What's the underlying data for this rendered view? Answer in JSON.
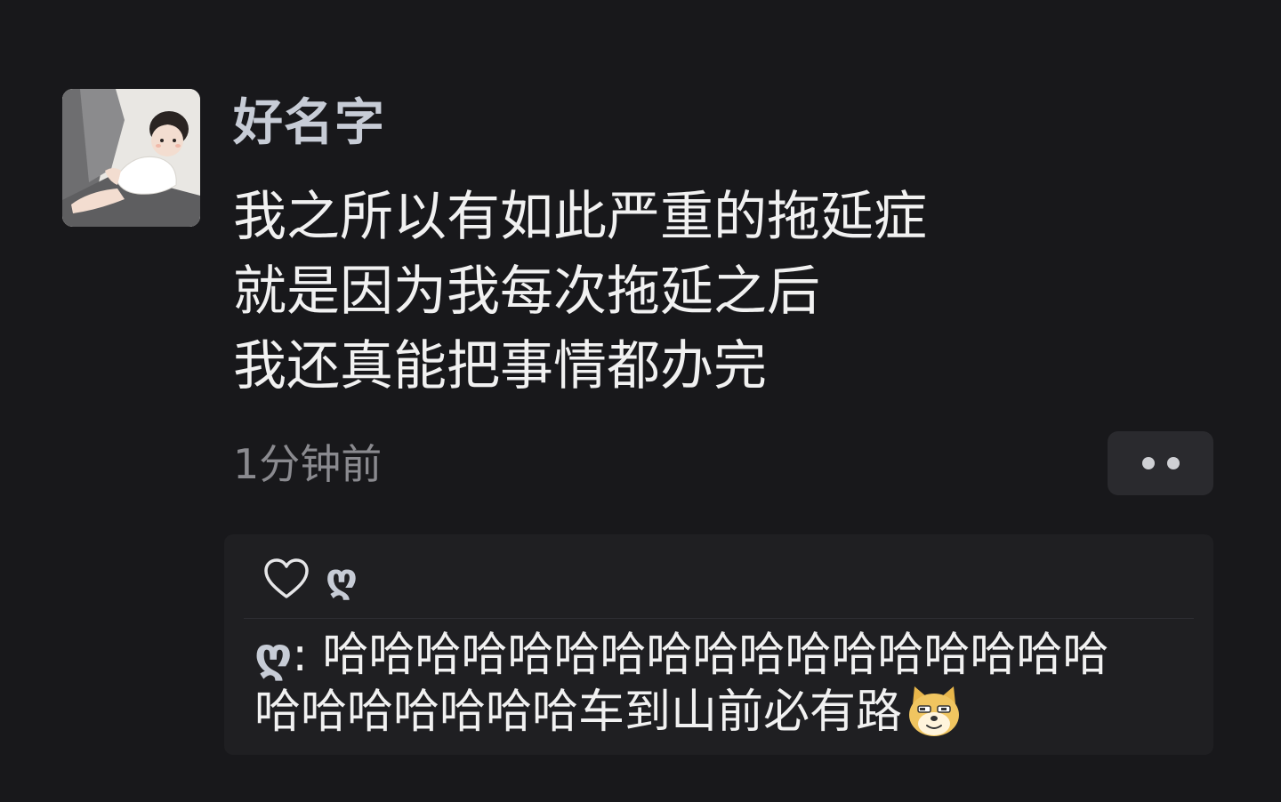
{
  "post": {
    "username": "好名字",
    "lines": [
      "我之所以有如此严重的拖延症",
      "就是因为我每次拖延之后",
      "我还真能把事情都办完"
    ],
    "timestamp": "1分钟前"
  },
  "reply_panel": {
    "likes": {
      "icon": "heart-outline-icon",
      "liker": "ღ"
    },
    "reply": {
      "author": "ღ",
      "separator": ": ",
      "line1": "哈哈哈哈哈哈哈哈哈哈哈哈哈哈哈哈哈",
      "line2": "哈哈哈哈哈哈哈车到山前必有路",
      "emoji": "doge-emoji-icon"
    }
  }
}
